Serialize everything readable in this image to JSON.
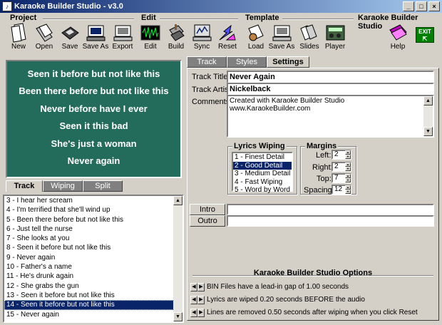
{
  "window": {
    "title": "Karaoke Builder Studio - v3.0",
    "brand": "Karaoke Builder Studio"
  },
  "groups": {
    "project": "Project",
    "edit": "Edit",
    "template": "Template"
  },
  "toolbar": {
    "new": "New",
    "open": "Open",
    "save": "Save",
    "save_as": "Save As",
    "export": "Export",
    "edit": "Edit",
    "build": "Build",
    "sync": "Sync",
    "reset": "Reset",
    "load": "Load",
    "tpl_save_as": "Save As",
    "slides": "Slides",
    "player": "Player",
    "help": "Help",
    "exit": "EXIT"
  },
  "preview": {
    "lines": [
      "Seen it before but not like this",
      "Been there before but not like this",
      "Never before have I ever",
      "Seen it this bad",
      "She's just a woman",
      "Never again"
    ]
  },
  "left_tabs": [
    "Track",
    "Wiping",
    "Split"
  ],
  "tracks": [
    "3 - I hear her scream",
    "4 - I'm terrified that she'll wind up",
    "5 - Been there before but not like this",
    "6 - Just tell the nurse",
    "7 - She looks at you",
    "8 - Seen it before but not like this",
    "9 - Never again",
    "10 - Father's a name",
    "11 - He's drunk again",
    "12 - She grabs the gun",
    "13 - Seen it before but not like this",
    "14 - Seen it before but not like this",
    "15 - Never again"
  ],
  "selected_track_index": 11,
  "right_tabs": [
    "Track",
    "Styles",
    "Settings"
  ],
  "settings": {
    "title_label": "Track Title:",
    "title_value": "Never Again",
    "artist_label": "Track Artist:",
    "artist_value": "Nickelback",
    "comments_label": "Comments:",
    "comments_line1": "Created with Karaoke Builder Studio",
    "comments_line2": "www.KaraokeBuilder.com"
  },
  "wiping": {
    "title": "Lyrics Wiping",
    "options": [
      "1 - Finest Detail",
      "2 - Good Detail",
      "3 - Medium Detail",
      "4 - Fast Wiping",
      "5 - Word by Word"
    ],
    "selected_index": 1
  },
  "margins": {
    "title": "Margins",
    "left_label": "Left:",
    "left_value": "2",
    "right_label": "Right:",
    "right_value": "2",
    "top_label": "Top:",
    "top_value": "7",
    "spacing_label": "Spacing:",
    "spacing_value": "12"
  },
  "intro_label": "Intro",
  "outro_label": "Outro",
  "options": {
    "title": "Karaoke Builder Studio Options",
    "line1": "BIN Files have a lead-in gap of 1.00 seconds",
    "line2": "Lyrics are wiped 0.20 seconds BEFORE the audio",
    "line3": "Lines are removed 0.50 seconds after wiping when you click Reset"
  }
}
